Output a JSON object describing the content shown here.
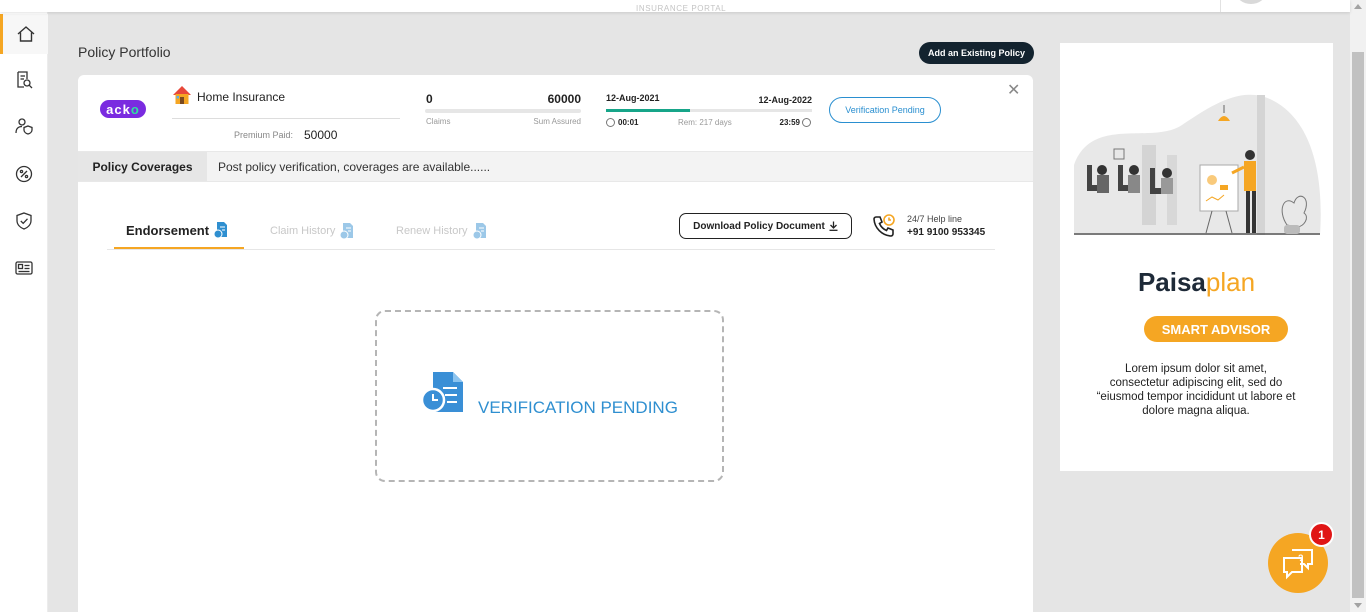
{
  "topbar": {
    "portal_label": "INSURANCE PORTAL"
  },
  "sidebar": {
    "items": [
      {
        "icon": "home-icon",
        "active": true
      },
      {
        "icon": "policy-search-icon",
        "active": false
      },
      {
        "icon": "user-shield-icon",
        "active": false
      },
      {
        "icon": "discount-icon",
        "active": false
      },
      {
        "icon": "shield-check-icon",
        "active": false
      },
      {
        "icon": "id-card-icon",
        "active": false
      }
    ]
  },
  "page": {
    "title": "Policy Portfolio",
    "add_button": "Add an Existing Policy"
  },
  "policy": {
    "insurer_logo": "acko",
    "name": "Home Insurance",
    "premium_label": "Premium Paid:",
    "premium_value": "50000",
    "claims_value": "0",
    "claims_label": "Claims",
    "sum_assured_value": "60000",
    "sum_assured_label": "Sum Assured",
    "start_date": "12-Aug-2021",
    "end_date": "12-Aug-2022",
    "elapsed_fraction": 0.41,
    "start_time": "00:01",
    "remaining": "Rem: 217 days",
    "end_time": "23:59",
    "status_button": "Verification Pending"
  },
  "coverage": {
    "label": "Policy Coverages",
    "text": "Post policy verification, coverages are available......"
  },
  "tabs": [
    {
      "label": "Endorsement",
      "active": true
    },
    {
      "label": "Claim History",
      "active": false
    },
    {
      "label": "Renew History",
      "active": false
    }
  ],
  "download_button": "Download Policy Document",
  "helpline": {
    "label": "24/7 Help line",
    "phone": "+91 9100 953345"
  },
  "status_box": {
    "text": "VERIFICATION PENDING"
  },
  "ad": {
    "brand_part1": "Paisa",
    "brand_part2": "plan",
    "button": "SMART ADVISOR",
    "text": "Lorem ipsum dolor sit amet, consectetur adipiscing elit, sed do “eiusmod tempor incididunt ut labore et dolore magna aliqua."
  },
  "chat": {
    "badge_count": "1"
  },
  "colors": {
    "accent": "#f5a623",
    "primary_blue": "#2f8fd0",
    "progress_green": "#17a589",
    "dark_navy": "#13232f"
  }
}
